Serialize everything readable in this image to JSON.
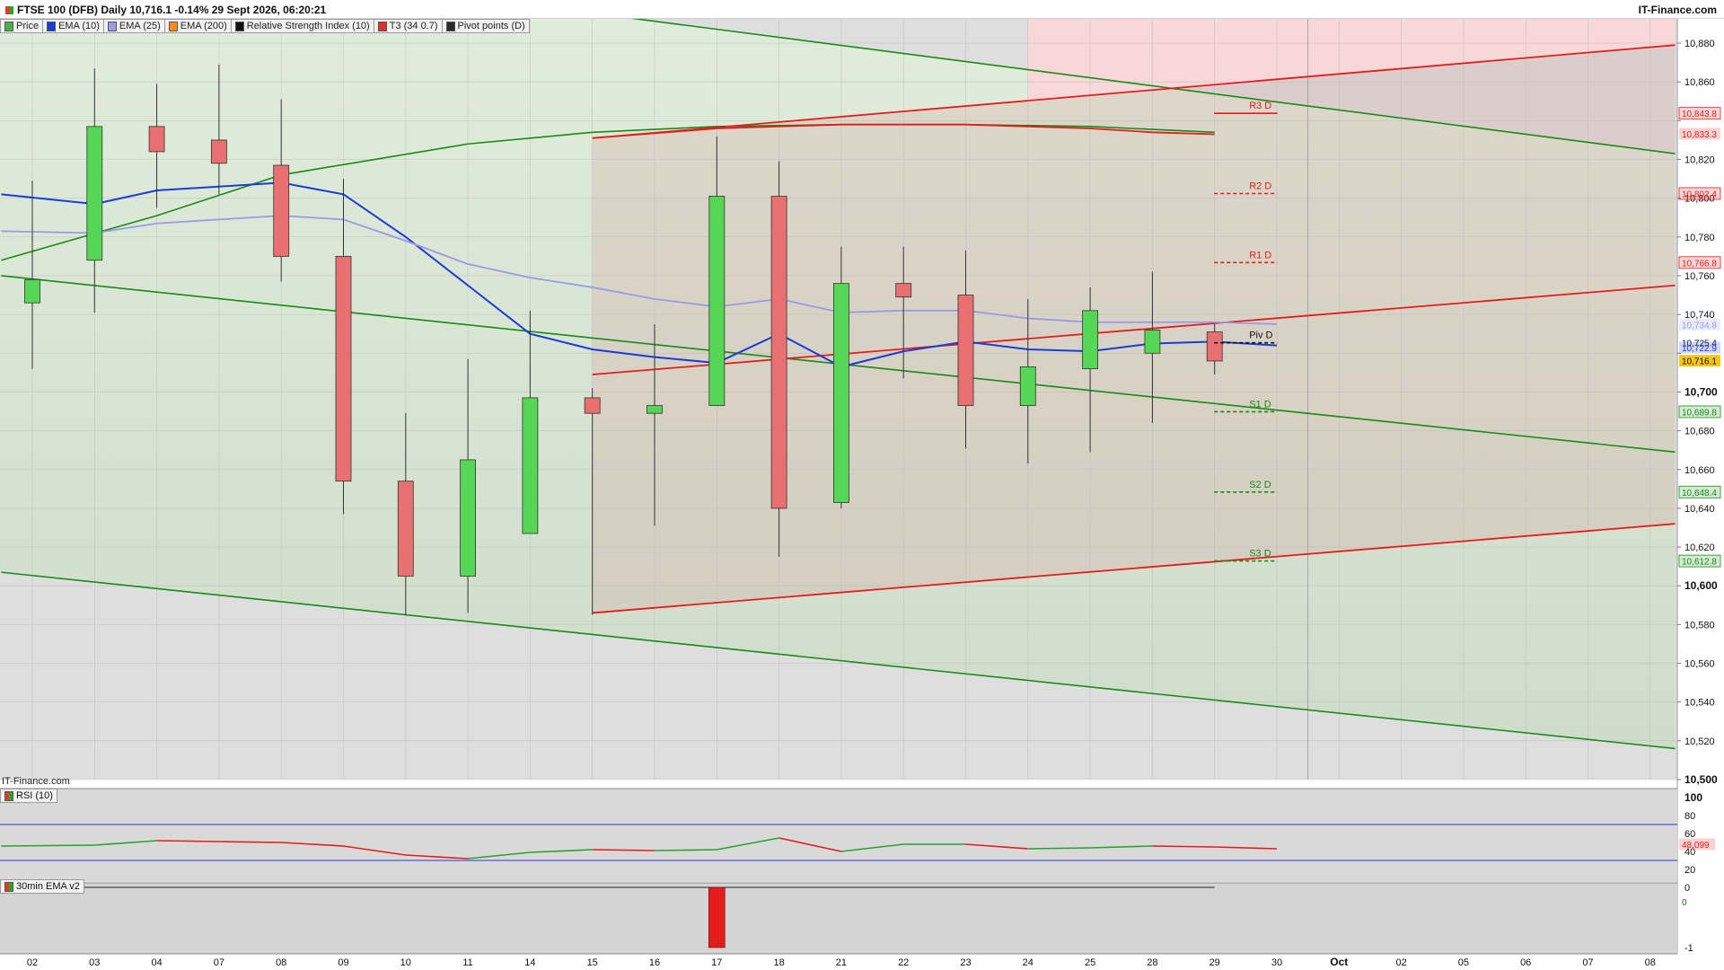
{
  "header": {
    "title": "FTSE 100 (DFB) Daily 10,716.1 -0.14% 29 Sept 2026, 06:20:21",
    "brand": "IT-Finance.com"
  },
  "legend": [
    {
      "label": "Price",
      "color": "#4caf50"
    },
    {
      "label": "EMA (10)",
      "color": "#1a3cd6"
    },
    {
      "label": "EMA (25)",
      "color": "#9a9ae8"
    },
    {
      "label": "EMA (200)",
      "color": "#ff8c1a"
    },
    {
      "label": "Relative Strength Index (10)",
      "color": "#111111"
    },
    {
      "label": "T3 (34 0.7)",
      "color": "#e03030"
    },
    {
      "label": "Pivot points (D)",
      "color": "#2a2a2a"
    }
  ],
  "watermark": "IT-Finance.com",
  "rsi_label": "RSI (10)",
  "ema30_label": "30min EMA v2",
  "colors": {
    "up": "#55d655",
    "down": "#e87070",
    "ema10": "#1a3cd6",
    "ema25": "#9a9ae8",
    "green_channel": "#178a17",
    "red_channel": "#e41c1c",
    "pivot": "#111111"
  },
  "chart_data": {
    "type": "candlestick",
    "x_labels": [
      "02",
      "03",
      "04",
      "07",
      "08",
      "09",
      "10",
      "11",
      "14",
      "15",
      "16",
      "17",
      "18",
      "21",
      "22",
      "23",
      "24",
      "25",
      "28",
      "29",
      "30",
      "Oct",
      "02",
      "05",
      "06",
      "07",
      "08"
    ],
    "y_ticks": [
      10500,
      10520,
      10540,
      10560,
      10580,
      10600,
      10620,
      10640,
      10660,
      10680,
      10700,
      10720,
      10740,
      10760,
      10780,
      10800,
      10820,
      10840,
      10860,
      10880
    ],
    "y_tick_labels": [
      "10,500",
      "10,520",
      "10,540",
      "10,560",
      "10,580",
      "10,600",
      "10,620",
      "10,640",
      "10,660",
      "10,680",
      "10,700",
      "",
      "10,740",
      "10,760",
      "10,780",
      "10,800",
      "10,820",
      "",
      "10,860",
      "10,880"
    ],
    "ylim": [
      10500,
      10893
    ],
    "candles": [
      {
        "x": "02",
        "o": 10746,
        "h": 10809,
        "l": 10712,
        "c": 10758
      },
      {
        "x": "03",
        "o": 10768,
        "h": 10867,
        "l": 10741,
        "c": 10837
      },
      {
        "x": "04",
        "o": 10837,
        "h": 10859,
        "l": 10795,
        "c": 10824
      },
      {
        "x": "07",
        "o": 10830,
        "h": 10869,
        "l": 10802,
        "c": 10818
      },
      {
        "x": "08",
        "o": 10817,
        "h": 10851,
        "l": 10757,
        "c": 10770
      },
      {
        "x": "09",
        "o": 10770,
        "h": 10810,
        "l": 10637,
        "c": 10654
      },
      {
        "x": "10",
        "o": 10654,
        "h": 10689,
        "l": 10585,
        "c": 10605
      },
      {
        "x": "11",
        "o": 10605,
        "h": 10717,
        "l": 10586,
        "c": 10665
      },
      {
        "x": "14",
        "o": 10627,
        "h": 10742,
        "l": 10627,
        "c": 10697
      },
      {
        "x": "15",
        "o": 10697,
        "h": 10702,
        "l": 10585,
        "c": 10689
      },
      {
        "x": "16",
        "o": 10689,
        "h": 10735,
        "l": 10631,
        "c": 10693
      },
      {
        "x": "17",
        "o": 10693,
        "h": 10832,
        "l": 10693,
        "c": 10801
      },
      {
        "x": "18",
        "o": 10801,
        "h": 10819,
        "l": 10615,
        "c": 10640
      },
      {
        "x": "21",
        "o": 10643,
        "h": 10775,
        "l": 10640,
        "c": 10756
      },
      {
        "x": "22",
        "o": 10756,
        "h": 10775,
        "l": 10707,
        "c": 10749
      },
      {
        "x": "23",
        "o": 10750,
        "h": 10773,
        "l": 10671,
        "c": 10693
      },
      {
        "x": "24",
        "o": 10693,
        "h": 10748,
        "l": 10663,
        "c": 10713
      },
      {
        "x": "25",
        "o": 10712,
        "h": 10754,
        "l": 10669,
        "c": 10742
      },
      {
        "x": "28",
        "o": 10720,
        "h": 10762,
        "l": 10684,
        "c": 10732
      },
      {
        "x": "29",
        "o": 10731,
        "h": 10735,
        "l": 10709,
        "c": 10716
      }
    ],
    "series": [
      {
        "name": "EMA (10)",
        "values": [
          10802,
          10797,
          10804,
          10806,
          10808,
          10802,
          10780,
          10755,
          10730,
          10722,
          10718,
          10715,
          10730,
          10713,
          10721,
          10726,
          10722,
          10721,
          10725,
          10726,
          10724
        ]
      },
      {
        "name": "EMA (25)",
        "values": [
          10783,
          10782,
          10787,
          10789,
          10791,
          10789,
          10778,
          10766,
          10759,
          10754,
          10748,
          10744,
          10748,
          10741,
          10742,
          10742,
          10738,
          10736,
          10736,
          10736,
          10735
        ]
      }
    ],
    "pivot_levels": [
      {
        "label": "R3 D",
        "value": 10843.8,
        "tag": "10,843.8",
        "color": "#e41c1c"
      },
      {
        "label": "R2 D",
        "value": 10802.4,
        "tag": "10,802.4",
        "color": "#e41c1c"
      },
      {
        "label": "R1 D",
        "value": 10766.8,
        "tag": "10,766.8",
        "color": "#e41c1c"
      },
      {
        "label": "Piv D",
        "value": 10725.4,
        "tag": "10,725.4",
        "color": "#111111"
      },
      {
        "label": "S1 D",
        "value": 10689.8,
        "tag": "10,689.8",
        "color": "#178a17"
      },
      {
        "label": "S2 D",
        "value": 10648.4,
        "tag": "10,648.4",
        "color": "#178a17"
      },
      {
        "label": "S3 D",
        "value": 10612.8,
        "tag": "10,612.8",
        "color": "#178a17"
      }
    ],
    "value_tags": [
      {
        "value": 10833.3,
        "label": "10,833.3",
        "color": "#e41c1c"
      },
      {
        "value": 10734.8,
        "label": "10,734.8",
        "color": "#9a9ae8"
      },
      {
        "value": 10722.9,
        "label": "10,722.9",
        "color": "#1a3cd6"
      },
      {
        "value": 10716.1,
        "label": "10,716.1",
        "color": "#e8a000"
      }
    ],
    "green_channel": {
      "upper": [
        {
          "x": 0,
          "y": 10933
        },
        {
          "x": 26.4,
          "y": 10823
        }
      ],
      "middle": [
        {
          "x": -0.5,
          "y": 10760
        },
        {
          "x": 26.4,
          "y": 10669
        }
      ],
      "lower": [
        {
          "x": -0.5,
          "y": 10607
        },
        {
          "x": 26.4,
          "y": 10516
        }
      ],
      "arc": [
        {
          "x": -0.5,
          "y": 10768
        },
        {
          "x": 2,
          "y": 10791
        },
        {
          "x": 4,
          "y": 10812
        },
        {
          "x": 7,
          "y": 10828
        },
        {
          "x": 9,
          "y": 10834
        },
        {
          "x": 11,
          "y": 10837
        },
        {
          "x": 13,
          "y": 10838
        },
        {
          "x": 15,
          "y": 10838
        },
        {
          "x": 17,
          "y": 10837
        },
        {
          "x": 19,
          "y": 10834
        }
      ]
    },
    "red_channel": {
      "upper": [
        {
          "x": 9,
          "y": 10831
        },
        {
          "x": 26.4,
          "y": 10879
        }
      ],
      "middle": [
        {
          "x": 9,
          "y": 10709
        },
        {
          "x": 26.4,
          "y": 10755
        }
      ],
      "lower": [
        {
          "x": 9,
          "y": 10586
        },
        {
          "x": 26.4,
          "y": 10632
        }
      ]
    },
    "rsi": {
      "ticks": [
        100,
        80,
        60,
        40,
        20
      ],
      "ylim": [
        10,
        100
      ],
      "levels": [
        70,
        30
      ],
      "values": [
        46,
        47,
        52,
        51,
        50,
        46,
        36,
        32,
        39,
        42,
        41,
        42,
        55,
        40,
        48,
        48,
        43,
        44,
        46,
        45,
        43
      ],
      "current": 48.099,
      "current_label": "48.099"
    },
    "ema30": {
      "ticks": [
        0,
        -1
      ],
      "tick_labels": [
        "0",
        "-1"
      ],
      "bar_index": 11,
      "bar_value": -1,
      "right_tag": "0"
    }
  }
}
